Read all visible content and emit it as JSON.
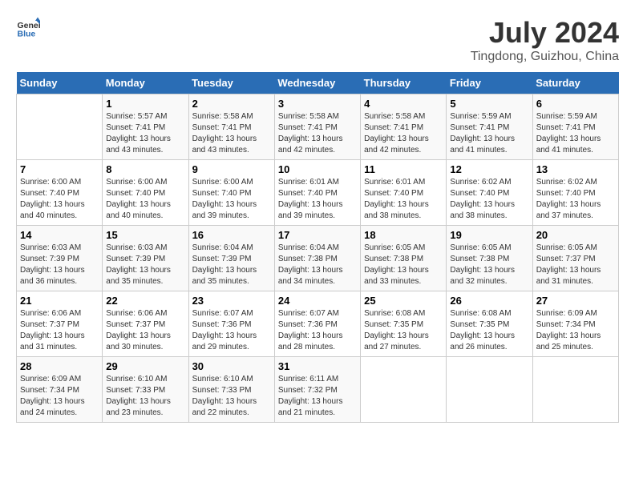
{
  "logo": {
    "line1": "General",
    "line2": "Blue"
  },
  "title": "July 2024",
  "subtitle": "Tingdong, Guizhou, China",
  "header_color": "#2a6db5",
  "days_of_week": [
    "Sunday",
    "Monday",
    "Tuesday",
    "Wednesday",
    "Thursday",
    "Friday",
    "Saturday"
  ],
  "weeks": [
    [
      {
        "day": "",
        "info": ""
      },
      {
        "day": "1",
        "info": "Sunrise: 5:57 AM\nSunset: 7:41 PM\nDaylight: 13 hours\nand 43 minutes."
      },
      {
        "day": "2",
        "info": "Sunrise: 5:58 AM\nSunset: 7:41 PM\nDaylight: 13 hours\nand 43 minutes."
      },
      {
        "day": "3",
        "info": "Sunrise: 5:58 AM\nSunset: 7:41 PM\nDaylight: 13 hours\nand 42 minutes."
      },
      {
        "day": "4",
        "info": "Sunrise: 5:58 AM\nSunset: 7:41 PM\nDaylight: 13 hours\nand 42 minutes."
      },
      {
        "day": "5",
        "info": "Sunrise: 5:59 AM\nSunset: 7:41 PM\nDaylight: 13 hours\nand 41 minutes."
      },
      {
        "day": "6",
        "info": "Sunrise: 5:59 AM\nSunset: 7:41 PM\nDaylight: 13 hours\nand 41 minutes."
      }
    ],
    [
      {
        "day": "7",
        "info": "Sunrise: 6:00 AM\nSunset: 7:40 PM\nDaylight: 13 hours\nand 40 minutes."
      },
      {
        "day": "8",
        "info": "Sunrise: 6:00 AM\nSunset: 7:40 PM\nDaylight: 13 hours\nand 40 minutes."
      },
      {
        "day": "9",
        "info": "Sunrise: 6:00 AM\nSunset: 7:40 PM\nDaylight: 13 hours\nand 39 minutes."
      },
      {
        "day": "10",
        "info": "Sunrise: 6:01 AM\nSunset: 7:40 PM\nDaylight: 13 hours\nand 39 minutes."
      },
      {
        "day": "11",
        "info": "Sunrise: 6:01 AM\nSunset: 7:40 PM\nDaylight: 13 hours\nand 38 minutes."
      },
      {
        "day": "12",
        "info": "Sunrise: 6:02 AM\nSunset: 7:40 PM\nDaylight: 13 hours\nand 38 minutes."
      },
      {
        "day": "13",
        "info": "Sunrise: 6:02 AM\nSunset: 7:40 PM\nDaylight: 13 hours\nand 37 minutes."
      }
    ],
    [
      {
        "day": "14",
        "info": "Sunrise: 6:03 AM\nSunset: 7:39 PM\nDaylight: 13 hours\nand 36 minutes."
      },
      {
        "day": "15",
        "info": "Sunrise: 6:03 AM\nSunset: 7:39 PM\nDaylight: 13 hours\nand 35 minutes."
      },
      {
        "day": "16",
        "info": "Sunrise: 6:04 AM\nSunset: 7:39 PM\nDaylight: 13 hours\nand 35 minutes."
      },
      {
        "day": "17",
        "info": "Sunrise: 6:04 AM\nSunset: 7:38 PM\nDaylight: 13 hours\nand 34 minutes."
      },
      {
        "day": "18",
        "info": "Sunrise: 6:05 AM\nSunset: 7:38 PM\nDaylight: 13 hours\nand 33 minutes."
      },
      {
        "day": "19",
        "info": "Sunrise: 6:05 AM\nSunset: 7:38 PM\nDaylight: 13 hours\nand 32 minutes."
      },
      {
        "day": "20",
        "info": "Sunrise: 6:05 AM\nSunset: 7:37 PM\nDaylight: 13 hours\nand 31 minutes."
      }
    ],
    [
      {
        "day": "21",
        "info": "Sunrise: 6:06 AM\nSunset: 7:37 PM\nDaylight: 13 hours\nand 31 minutes."
      },
      {
        "day": "22",
        "info": "Sunrise: 6:06 AM\nSunset: 7:37 PM\nDaylight: 13 hours\nand 30 minutes."
      },
      {
        "day": "23",
        "info": "Sunrise: 6:07 AM\nSunset: 7:36 PM\nDaylight: 13 hours\nand 29 minutes."
      },
      {
        "day": "24",
        "info": "Sunrise: 6:07 AM\nSunset: 7:36 PM\nDaylight: 13 hours\nand 28 minutes."
      },
      {
        "day": "25",
        "info": "Sunrise: 6:08 AM\nSunset: 7:35 PM\nDaylight: 13 hours\nand 27 minutes."
      },
      {
        "day": "26",
        "info": "Sunrise: 6:08 AM\nSunset: 7:35 PM\nDaylight: 13 hours\nand 26 minutes."
      },
      {
        "day": "27",
        "info": "Sunrise: 6:09 AM\nSunset: 7:34 PM\nDaylight: 13 hours\nand 25 minutes."
      }
    ],
    [
      {
        "day": "28",
        "info": "Sunrise: 6:09 AM\nSunset: 7:34 PM\nDaylight: 13 hours\nand 24 minutes."
      },
      {
        "day": "29",
        "info": "Sunrise: 6:10 AM\nSunset: 7:33 PM\nDaylight: 13 hours\nand 23 minutes."
      },
      {
        "day": "30",
        "info": "Sunrise: 6:10 AM\nSunset: 7:33 PM\nDaylight: 13 hours\nand 22 minutes."
      },
      {
        "day": "31",
        "info": "Sunrise: 6:11 AM\nSunset: 7:32 PM\nDaylight: 13 hours\nand 21 minutes."
      },
      {
        "day": "",
        "info": ""
      },
      {
        "day": "",
        "info": ""
      },
      {
        "day": "",
        "info": ""
      }
    ]
  ]
}
